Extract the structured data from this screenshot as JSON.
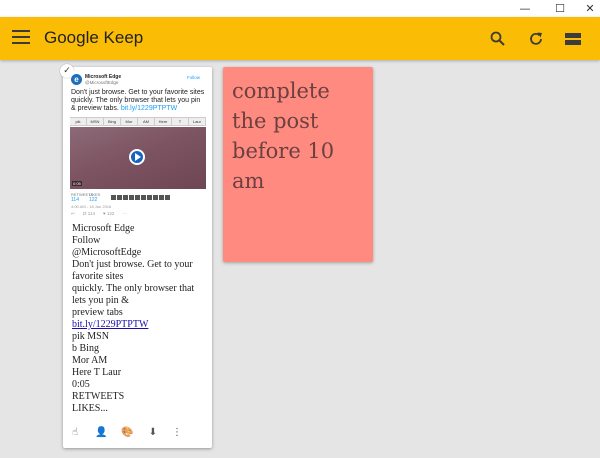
{
  "window": {
    "minimize_glyph": "—",
    "maximize_glyph": "☐",
    "close_glyph": "✕"
  },
  "header": {
    "title": "Google Keep",
    "icons": [
      "menu-icon",
      "search-icon",
      "refresh-icon",
      "view-toggle-icon"
    ],
    "bar_color": "#fbbc05"
  },
  "note1": {
    "check_glyph": "✓",
    "tweet": {
      "logo_letter": "e",
      "name": "Microsoft Edge",
      "handle": "@MicrosoftEdge",
      "follow_label": "Follow",
      "text": "Don't just browse. Get to your favorite sites quickly. The only browser that lets you pin & preview tabs.",
      "link": "bit.ly/1229PTPTW",
      "tabs": [
        "pik",
        "MSN",
        "Bing",
        "Mor",
        "AM",
        "Here",
        "T",
        "Laur"
      ],
      "video_time": "0:05",
      "retweets_label": "RETWEETS",
      "retweets_count": "114",
      "likes_label": "LIKES",
      "likes_count": "122",
      "date": "4:00 AM - 16 Jun 2016",
      "actions": [
        "↩",
        "⇄ 114",
        "♥ 122",
        "···"
      ]
    },
    "lines": [
      "Microsoft Edge",
      "Follow",
      "@MicrosoftEdge",
      "Don't just browse. Get to your",
      "favorite sites",
      "quickly. The only browser that",
      "lets you pin &",
      "preview tabs",
      "bit.ly/1229PTPTW",
      "pik MSN",
      "b Bing",
      "Mor AM",
      "Here T Laur",
      "0:05",
      "RETWEETS",
      "LIKES..."
    ],
    "toolbar": [
      {
        "name": "reminder-icon",
        "glyph": "☝"
      },
      {
        "name": "collaborator-icon",
        "glyph": "👤"
      },
      {
        "name": "color-palette-icon",
        "glyph": "🎨"
      },
      {
        "name": "archive-icon",
        "glyph": "⬇"
      },
      {
        "name": "more-icon",
        "glyph": "⋮"
      }
    ]
  },
  "note2": {
    "text": "complete the post before 10 am",
    "color": "#ff8a80"
  }
}
